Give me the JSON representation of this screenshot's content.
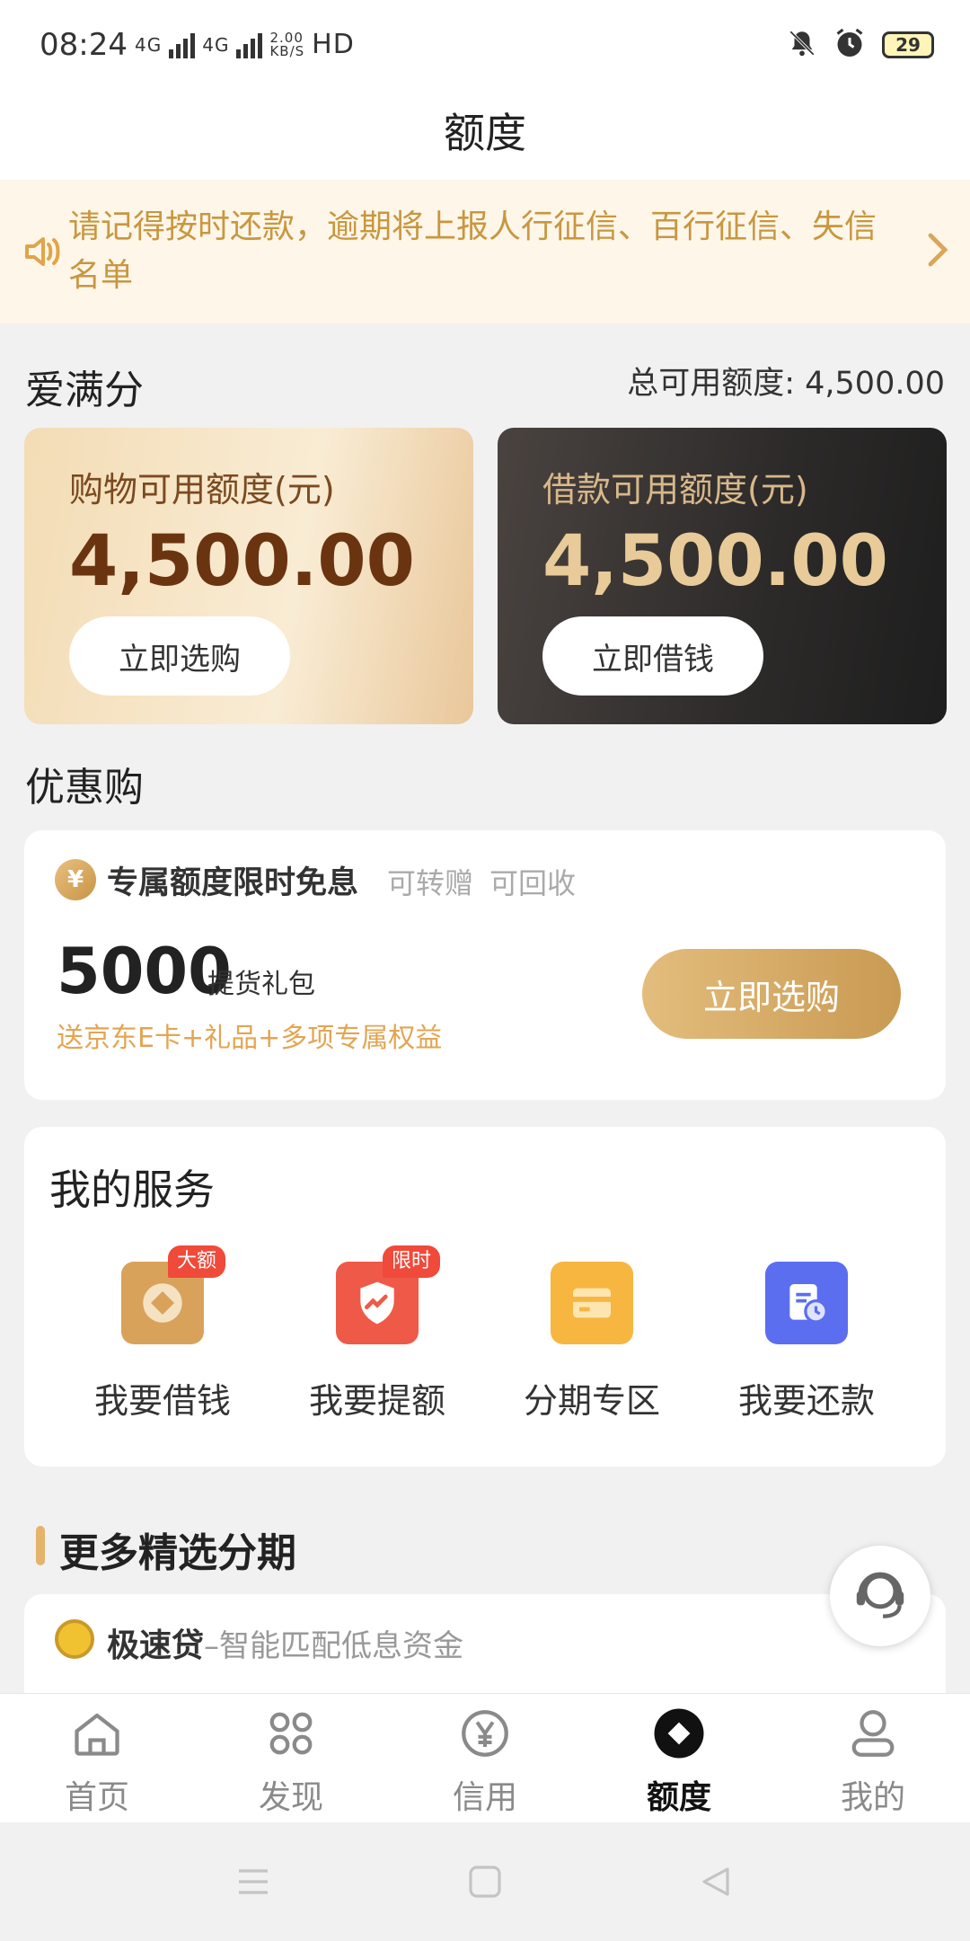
{
  "status_bar": {
    "time": "08:24",
    "network": "4G",
    "speed": "2.00\nKB/S",
    "hd": "HD",
    "battery": "29"
  },
  "page_title": "额度",
  "notice": {
    "text": "请记得按时还款，逾期将上报人行征信、百行征信、失信名单"
  },
  "credit": {
    "name": "爱满分",
    "total_label": "总可用额度: 4,500.00"
  },
  "cards": {
    "shopping": {
      "label": "购物可用额度(元)",
      "amount": "4,500.00",
      "button": "立即选购"
    },
    "loan": {
      "label": "借款可用额度(元)",
      "amount": "4,500.00",
      "button": "立即借钱"
    }
  },
  "promo_section": {
    "title": "优惠购",
    "icon": "¥",
    "headline": "专属额度限时免息",
    "tag1": "可转赠",
    "tag2": "可回收",
    "amount": "5000",
    "package": "提货礼包",
    "subtitle": "送京东E卡+礼品+多项专属权益",
    "button": "立即选购"
  },
  "services": {
    "title": "我的服务",
    "items": [
      {
        "label": "我要借钱",
        "badge": "大额",
        "icon": "borrow-icon",
        "color": "#d9a25a"
      },
      {
        "label": "我要提额",
        "badge": "限时",
        "icon": "raise-limit-icon",
        "color": "#ef5a48"
      },
      {
        "label": "分期专区",
        "badge": "",
        "icon": "installment-card-icon",
        "color": "#f7b640"
      },
      {
        "label": "我要还款",
        "badge": "",
        "icon": "repay-calendar-icon",
        "color": "#5b6ef0"
      }
    ]
  },
  "more": {
    "title": "更多精选分期",
    "item_name": "极速贷",
    "item_desc": "–智能匹配低息资金"
  },
  "tabs": [
    {
      "label": "首页",
      "icon": "home-icon"
    },
    {
      "label": "发现",
      "icon": "discover-grid-icon"
    },
    {
      "label": "信用",
      "icon": "credit-yen-icon"
    },
    {
      "label": "额度",
      "icon": "quota-diamond-icon",
      "active": true
    },
    {
      "label": "我的",
      "icon": "profile-icon"
    }
  ]
}
